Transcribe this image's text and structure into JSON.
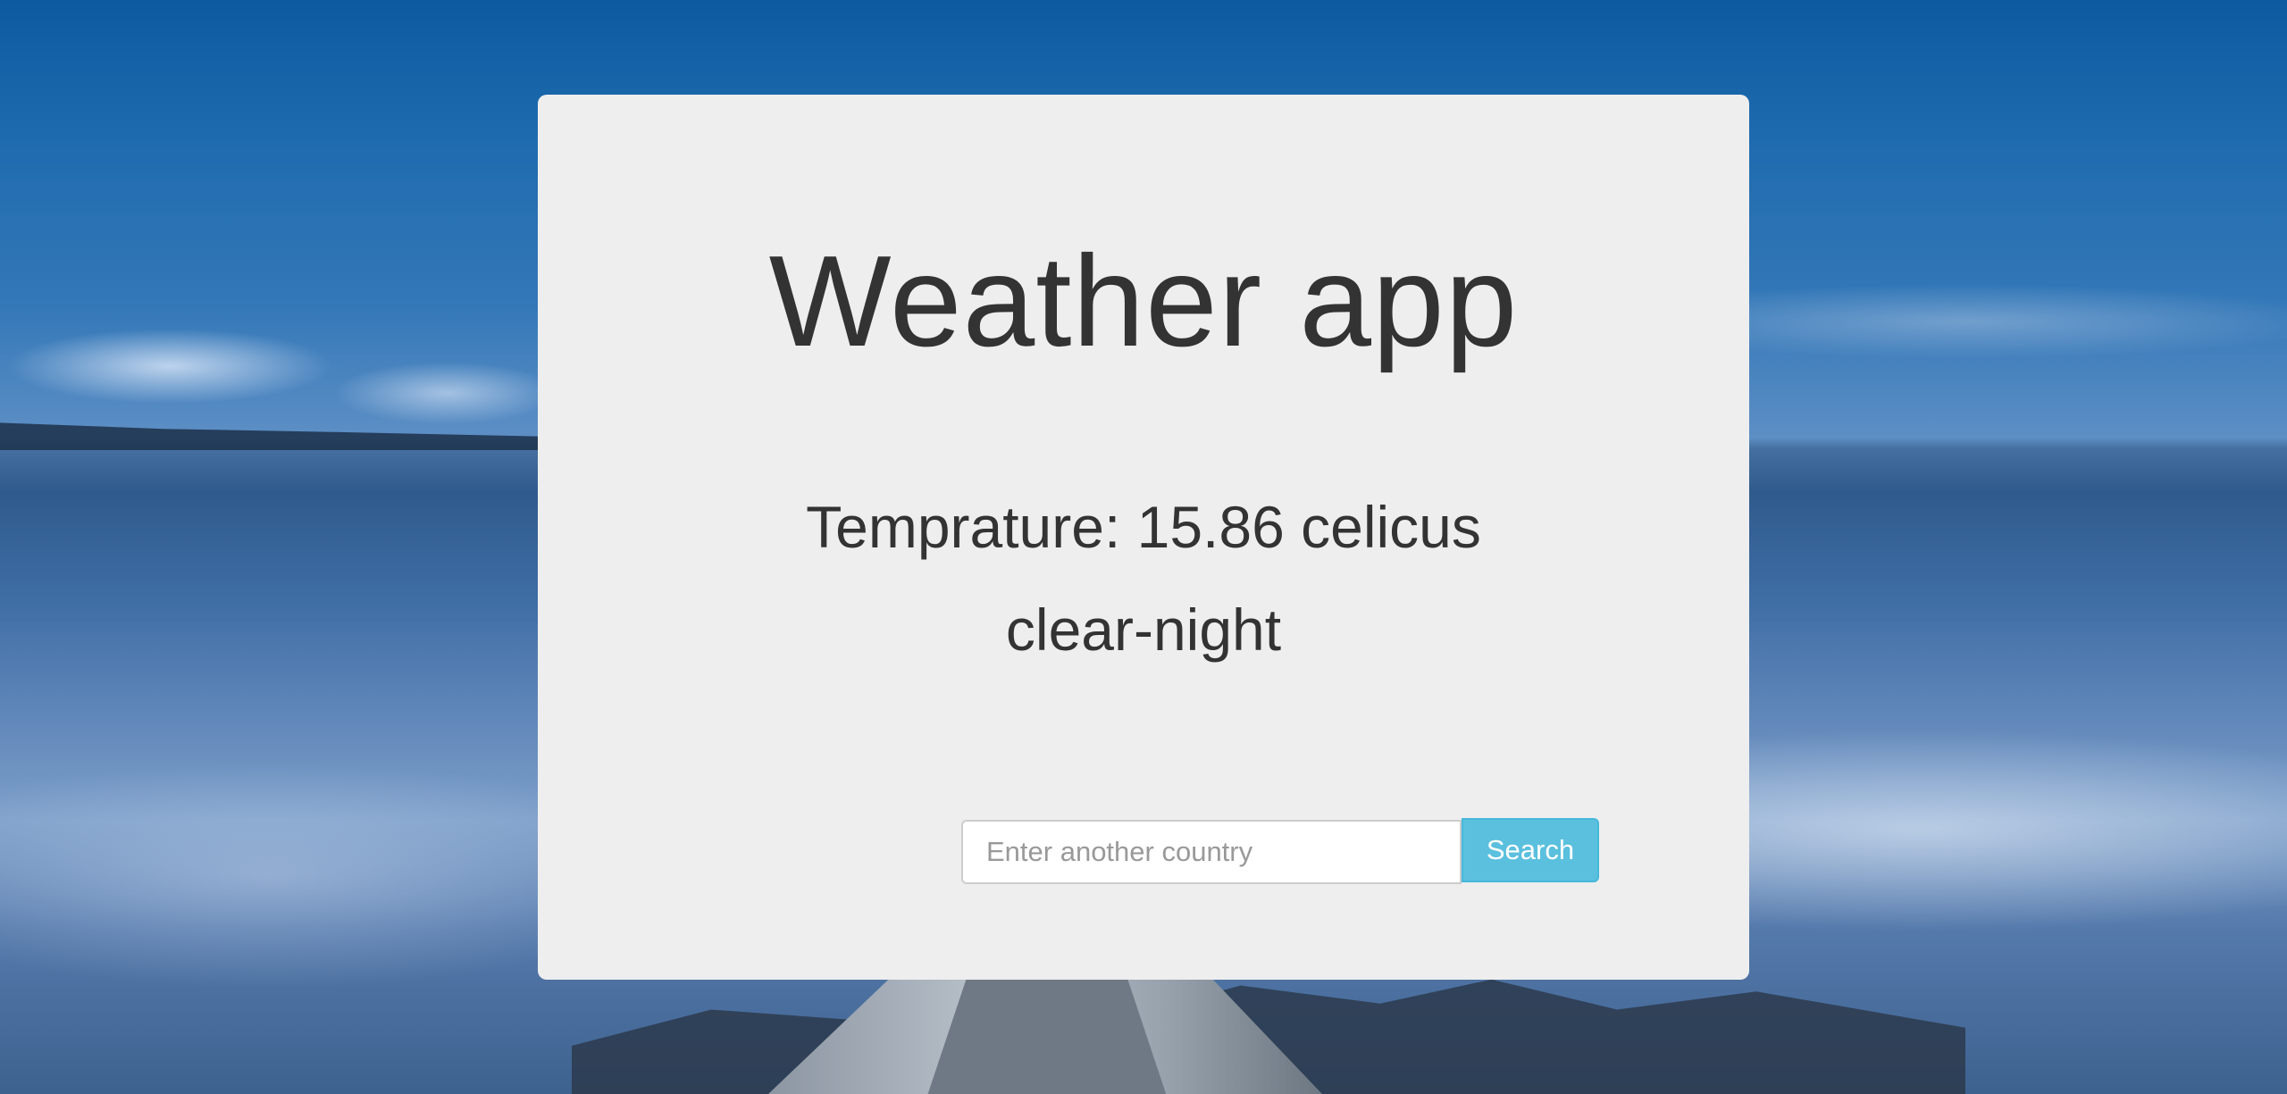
{
  "app": {
    "title": "Weather app"
  },
  "weather": {
    "temperature_text": "Temprature: 15.86 celicus",
    "summary": "clear-night"
  },
  "search": {
    "placeholder": "Enter another country",
    "value": "",
    "button_label": "Search"
  },
  "colors": {
    "card_background": "#eeeeee",
    "text": "#333333",
    "button_background": "#5bc0de",
    "button_text": "#ffffff"
  }
}
